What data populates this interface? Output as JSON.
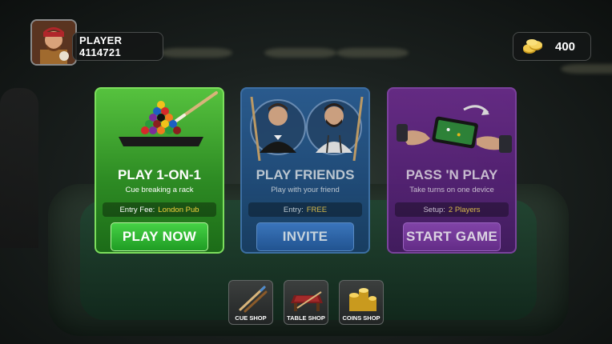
{
  "player": {
    "name": "PLAYER 4114721"
  },
  "coins": {
    "amount": "400"
  },
  "modes": [
    {
      "title": "PLAY 1-ON-1",
      "subtitle": "Cue breaking a rack",
      "info_label": "Entry Fee:",
      "info_value": "London Pub",
      "action": "PLAY NOW"
    },
    {
      "title": "PLAY FRIENDS",
      "subtitle": "Play with your friend",
      "info_label": "Entry:",
      "info_value": "FREE",
      "action": "INVITE"
    },
    {
      "title": "PASS 'N PLAY",
      "subtitle": "Take turns on one device",
      "info_label": "Setup:",
      "info_value": "2 Players",
      "action": "START GAME"
    }
  ],
  "shops": [
    {
      "label": "CUE SHOP",
      "icon": "cue-icon"
    },
    {
      "label": "TABLE SHOP",
      "icon": "table-icon"
    },
    {
      "label": "COINS SHOP",
      "icon": "coins-stack-icon"
    }
  ],
  "colors": {
    "green": "#3aa32e",
    "blue": "#2b5f96",
    "purple": "#6b2c8c",
    "gold": "#f4d23c"
  }
}
